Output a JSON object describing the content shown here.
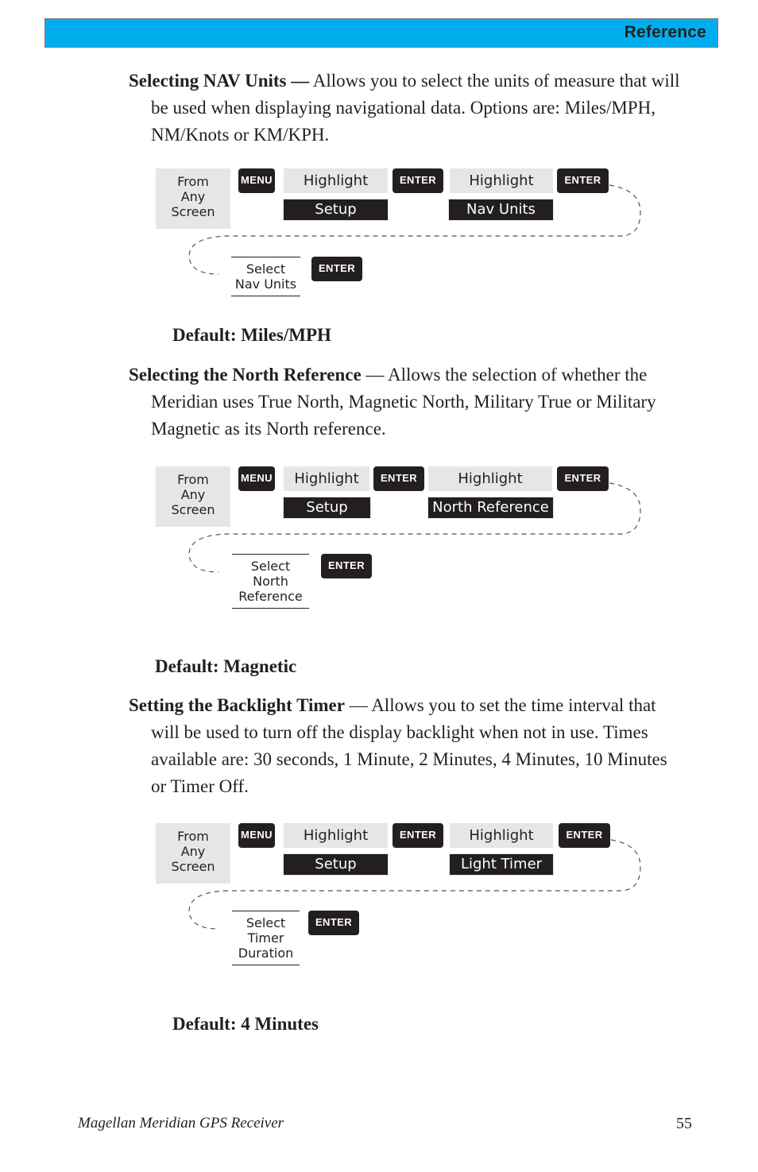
{
  "header": {
    "title": "Reference",
    "bar_color": "#00aeef"
  },
  "sections": [
    {
      "term": "Selecting NAV Units —",
      "lines": [
        " Allows you to select the units of measure that will",
        "be used when displaying navigational data.  Options are:  Miles/MPH,",
        "NM/Knots or KM/KPH."
      ],
      "diagram": {
        "start": [
          "From",
          "Any",
          "Screen"
        ],
        "key1": "MENU",
        "highlight1": "Highlight",
        "lcd1": "Setup",
        "key2": "ENTER",
        "highlight2": "Highlight",
        "lcd2": "Nav Units",
        "key3": "ENTER",
        "select": [
          "Select",
          "Nav Units"
        ],
        "key4": "ENTER"
      },
      "default": "Default: Miles/MPH"
    },
    {
      "term": "Selecting the North Reference",
      "lines": [
        " — Allows the selection of whether the",
        "Meridian uses True North, Magnetic North, Military True or Military",
        "Magnetic as its North reference."
      ],
      "diagram": {
        "start": [
          "From",
          "Any",
          "Screen"
        ],
        "key1": "MENU",
        "highlight1": "Highlight",
        "lcd1": "Setup",
        "key2": "ENTER",
        "highlight2": "Highlight",
        "lcd2": "North Reference",
        "key3": "ENTER",
        "select": [
          "Select",
          "North",
          "Reference"
        ],
        "key4": "ENTER"
      },
      "default": "Default: Magnetic"
    },
    {
      "term": "Setting the Backlight Timer",
      "lines": [
        "  — Allows you to set the time interval that",
        "will be used to turn off the display backlight when not in use.  Times",
        "available are: 30 seconds, 1 Minute, 2 Minutes, 4 Minutes, 10 Minutes",
        "or Timer Off."
      ],
      "diagram": {
        "start": [
          "From",
          "Any",
          "Screen"
        ],
        "key1": "MENU",
        "highlight1": "Highlight",
        "lcd1": "Setup",
        "key2": "ENTER",
        "highlight2": "Highlight",
        "lcd2": "Light Timer",
        "key3": "ENTER",
        "select": [
          "Select",
          "Timer",
          "Duration"
        ],
        "key4": "ENTER"
      },
      "default": "Default:  4 Minutes"
    }
  ],
  "footer": {
    "title": "Magellan Meridian GPS Receiver",
    "page_number": "55"
  }
}
